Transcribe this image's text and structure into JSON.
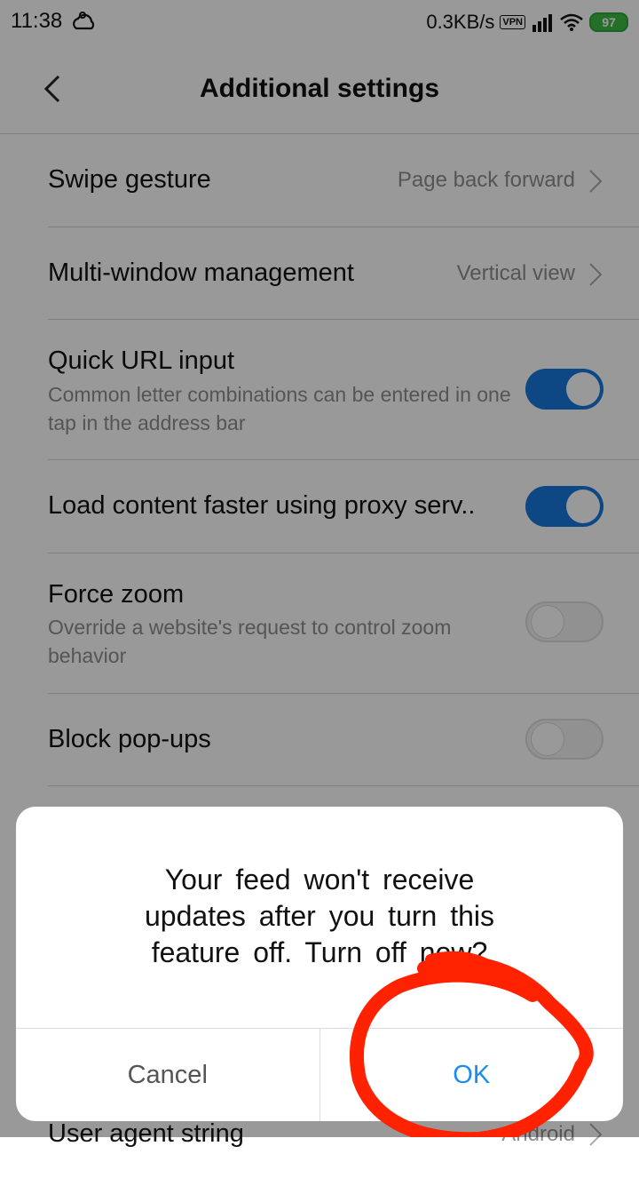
{
  "status_bar": {
    "time": "11:38",
    "network_speed": "0.3KB/s",
    "vpn_label": "VPN",
    "battery_level": "97",
    "icons": [
      "weather-icon",
      "vpn-icon",
      "signal-icon",
      "wifi-icon",
      "battery-icon"
    ]
  },
  "header": {
    "title": "Additional settings",
    "back_icon": "chevron-left-icon"
  },
  "settings": {
    "swipe_gesture": {
      "label": "Swipe gesture",
      "value": "Page back forward"
    },
    "multi_window": {
      "label": "Multi-window management",
      "value": "Vertical view"
    },
    "quick_url": {
      "label": "Quick URL input",
      "description": "Common letter combinations can be entered in one tap in the address bar",
      "enabled": true
    },
    "proxy": {
      "label": "Load content faster using proxy serv..",
      "enabled": true
    },
    "force_zoom": {
      "label": "Force zoom",
      "description": "Override a website's request to control zoom behavior",
      "enabled": false
    },
    "block_popups": {
      "label": "Block pop-ups",
      "enabled": false
    },
    "user_agent": {
      "label": "User agent string",
      "value": "Android"
    }
  },
  "dialog": {
    "message": "Your feed won't receive updates after you turn this feature off. Turn off now?",
    "cancel_label": "Cancel",
    "ok_label": "OK"
  },
  "colors": {
    "toggle_on": "#1677dd",
    "ok_text": "#1a8cf0",
    "annotation": "#ff2200"
  }
}
